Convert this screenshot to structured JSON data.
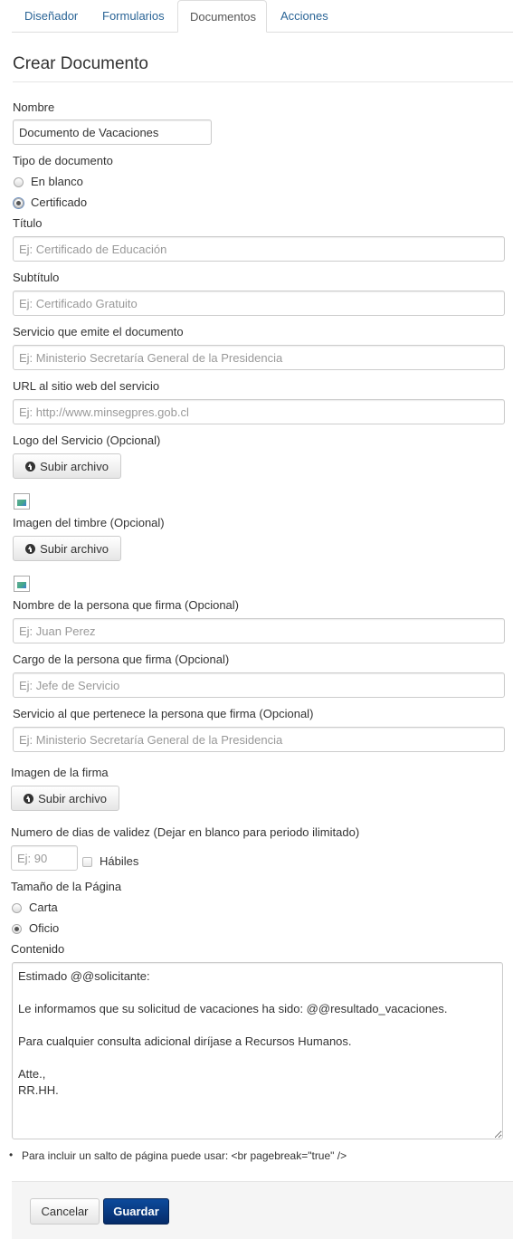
{
  "tabs": [
    {
      "label": "Diseñador"
    },
    {
      "label": "Formularios"
    },
    {
      "label": "Documentos"
    },
    {
      "label": "Acciones"
    }
  ],
  "title": "Crear Documento",
  "nombre": {
    "label": "Nombre",
    "value": "Documento de Vacaciones"
  },
  "tipo": {
    "label": "Tipo de documento",
    "option1": "En blanco",
    "option2": "Certificado",
    "selected": "Certificado"
  },
  "titulo": {
    "label": "Título",
    "placeholder": "Ej: Certificado de Educación"
  },
  "subtitulo": {
    "label": "Subtítulo",
    "placeholder": "Ej: Certificado Gratuito"
  },
  "servicio": {
    "label": "Servicio que emite el documento",
    "placeholder": "Ej: Ministerio Secretaría General de la Presidencia"
  },
  "url": {
    "label": "URL al sitio web del servicio",
    "placeholder": "Ej: http://www.minsegpres.gob.cl"
  },
  "logo": {
    "label": "Logo del Servicio (Opcional)",
    "button": "Subir archivo"
  },
  "timbre": {
    "label": "Imagen del timbre (Opcional)",
    "button": "Subir archivo"
  },
  "firmante_nombre": {
    "label": "Nombre de la persona que firma (Opcional)",
    "placeholder": "Ej: Juan Perez"
  },
  "firmante_cargo": {
    "label": "Cargo de la persona que firma (Opcional)",
    "placeholder": "Ej: Jefe de Servicio"
  },
  "firmante_servicio": {
    "label": "Servicio al que pertenece la persona que firma (Opcional)",
    "placeholder": "Ej: Ministerio Secretaría General de la Presidencia"
  },
  "firma": {
    "label": "Imagen de la firma",
    "button": "Subir archivo"
  },
  "validez": {
    "label": "Numero de dias de validez (Dejar en blanco para periodo ilimitado)",
    "placeholder": "Ej: 90",
    "habiles": "Hábiles"
  },
  "tamano": {
    "label": "Tamaño de la Página",
    "option1": "Carta",
    "option2": "Oficio",
    "selected": "Oficio"
  },
  "contenido": {
    "label": "Contenido",
    "value": "Estimado @@solicitante:\n\nLe informamos que su solicitud de vacaciones ha sido: @@resultado_vacaciones.\n\nPara cualquier consulta adicional diríjase a Recursos Humanos.\n\nAtte.,\nRR.HH."
  },
  "tip": "Para incluir un salto de página puede usar: <br pagebreak=\"true\" />",
  "actions": {
    "cancel": "Cancelar",
    "save": "Guardar"
  }
}
